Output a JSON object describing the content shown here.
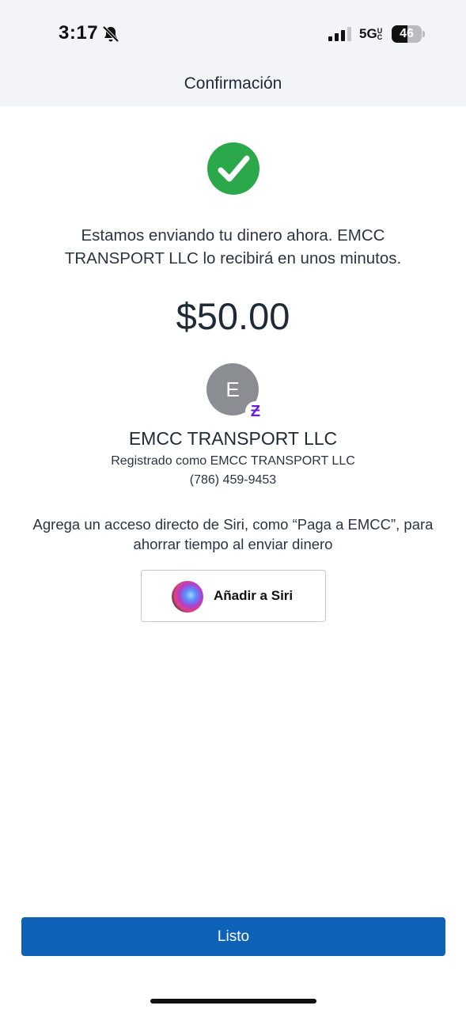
{
  "status_bar": {
    "time": "3:17",
    "network": "5G",
    "network_suffix": "UC",
    "battery": "46"
  },
  "nav": {
    "title": "Confirmación"
  },
  "confirmation": {
    "status_icon": "check-circle-icon",
    "message": "Estamos enviando tu dinero ahora. EMCC TRANSPORT LLC lo recibirá en unos minutos.",
    "amount": "$50.00",
    "accent_color": "#2aa84a"
  },
  "recipient": {
    "avatar_initial": "E",
    "badge_symbol": "Ƶ",
    "name": "EMCC TRANSPORT LLC",
    "registered_as": "Registrado como EMCC TRANSPORT LLC",
    "phone": "(786) 459-9453"
  },
  "siri": {
    "prompt": "Agrega un acceso directo de Siri, como “Paga a EMCC”, para ahorrar tiempo al enviar dinero",
    "button_label": "Añadir a Siri"
  },
  "footer": {
    "done_label": "Listo",
    "primary_color": "#0d62b8"
  }
}
